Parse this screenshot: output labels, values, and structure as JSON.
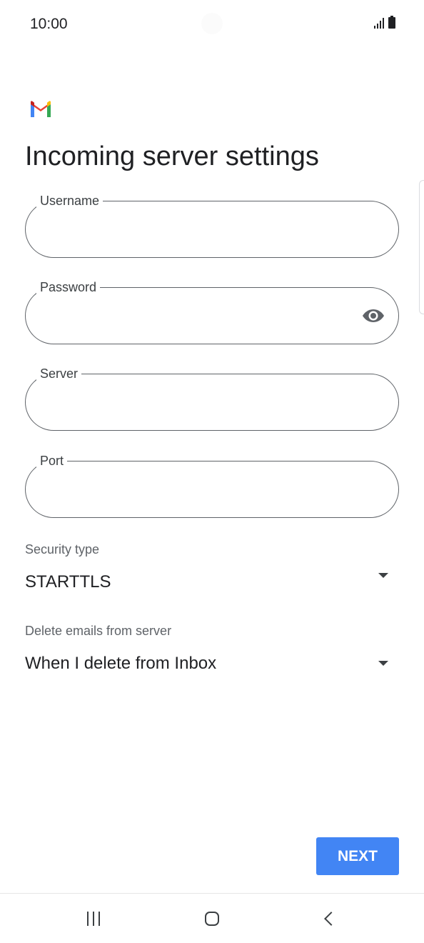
{
  "status_bar": {
    "time": "10:00"
  },
  "header": {
    "title": "Incoming server settings"
  },
  "form": {
    "username": {
      "label": "Username",
      "value": ""
    },
    "password": {
      "label": "Password",
      "value": ""
    },
    "server": {
      "label": "Server",
      "value": ""
    },
    "port": {
      "label": "Port",
      "value": ""
    }
  },
  "security": {
    "caption": "Security type",
    "value": "STARTTLS"
  },
  "delete_emails": {
    "caption": "Delete emails from server",
    "value": "When I delete from Inbox"
  },
  "actions": {
    "next_label": "NEXT"
  },
  "icons": {
    "logo": "gmail-logo",
    "password_toggle": "eye-icon",
    "nav": [
      "recents-icon",
      "home-icon",
      "back-icon"
    ]
  },
  "colors": {
    "accent": "#4285f4",
    "outline": "#5f6368"
  }
}
